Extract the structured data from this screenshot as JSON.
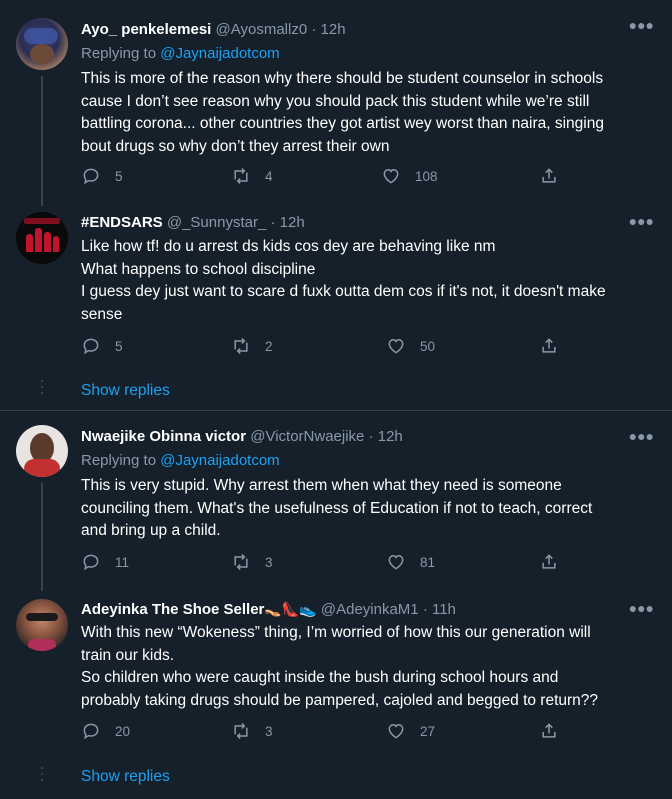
{
  "tweets": [
    {
      "name": "Ayo_ penkelemesi",
      "handle": "@Ayosmallz0",
      "time": "· 12h",
      "replying_prefix": "Replying to",
      "replying_to": "@Jaynaijadotcom",
      "lines": [
        "This is more of the reason why there should be student counselor in schools",
        "cause I don’t see reason why you should pack this student while we’re still",
        "battling corona... other countries they got artist wey worst than naira, singing",
        "bout drugs so why don’t they arrest their own"
      ],
      "replies": "5",
      "retweets": "4",
      "likes": "108"
    },
    {
      "name": "#ENDSARS",
      "handle": "@_Sunnystar_",
      "time": "· 12h",
      "lines": [
        "Like how tf! do u arrest ds kids cos dey are behaving like nm",
        "What happens to school discipline",
        "I guess dey just want to scare d fuxk outta dem cos if it's not, it doesn't make",
        "sense"
      ],
      "replies": "5",
      "retweets": "2",
      "likes": "50"
    },
    {
      "name": "Nwaejike Obinna victor",
      "handle": "@VictorNwaejike",
      "time": "· 12h",
      "replying_prefix": "Replying to",
      "replying_to": "@Jaynaijadotcom",
      "lines": [
        "This is very stupid. Why arrest them when what they need is someone",
        "counciling them. What's the usefulness of Education if not to teach, correct",
        "and bring up a child."
      ],
      "replies": "11",
      "retweets": "3",
      "likes": "81"
    },
    {
      "name": "Adeyinka The Shoe Seller",
      "name_emoji": "👡👠👟",
      "handle": "@AdeyinkaM1",
      "time": "· 11h",
      "lines": [
        "With this new “Wokeness” thing, I’m worried of how this our generation will",
        "train our kids.",
        "So children who were caught inside the bush during school hours and",
        "probably taking drugs should be pampered, cajoled and begged to return??"
      ],
      "replies": "20",
      "retweets": "3",
      "likes": "27"
    }
  ],
  "show_replies_label": "Show replies",
  "icons": {
    "reply": "reply-icon",
    "retweet": "retweet-icon",
    "like": "heart-icon",
    "share": "share-icon",
    "more": "more-icon"
  },
  "colors": {
    "background": "#15202b",
    "accent": "#1da1f2",
    "muted": "#8899a6",
    "divider": "#38444d"
  }
}
